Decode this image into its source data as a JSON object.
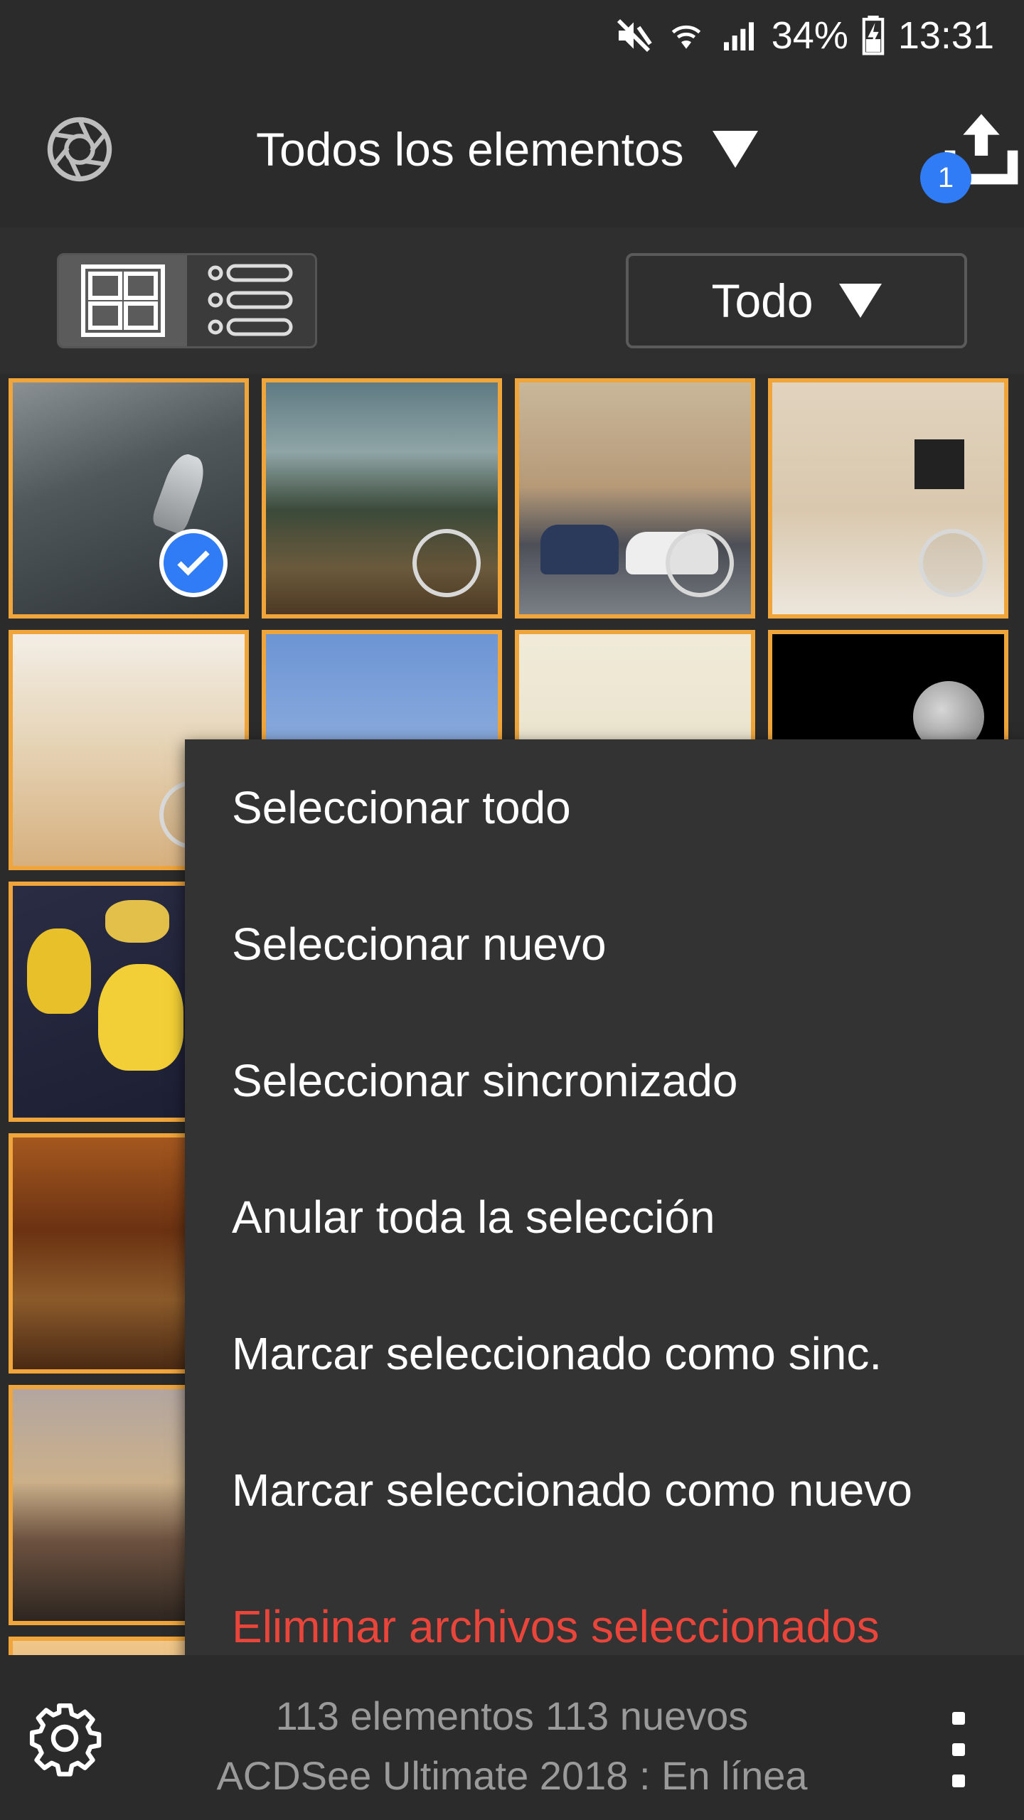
{
  "status_bar": {
    "battery": "34%",
    "time": "13:31"
  },
  "header": {
    "title": "Todos los elementos",
    "upload_badge": "1"
  },
  "toolbar": {
    "filter_label": "Todo"
  },
  "menu": {
    "items": [
      "Seleccionar todo",
      "Seleccionar nuevo",
      "Seleccionar sincronizado",
      "Anular toda la selección",
      "Marcar seleccionado como sinc.",
      "Marcar seleccionado como nuevo",
      "Eliminar archivos seleccionados"
    ]
  },
  "footer": {
    "count": "113 elementos",
    "new_count": "113 nuevos",
    "connection": "ACDSee Ultimate 2018 : En línea"
  },
  "colors": {
    "accent": "#f0a53a",
    "selection": "#2f7cf6",
    "danger": "#e9453a",
    "background": "#2b2b2b"
  },
  "icons": {
    "logo": "aperture-icon",
    "upload": "upload-icon",
    "grid_view": "grid-view-icon",
    "list_view": "list-view-icon",
    "settings": "gear-icon",
    "more": "more-vertical-icon"
  }
}
